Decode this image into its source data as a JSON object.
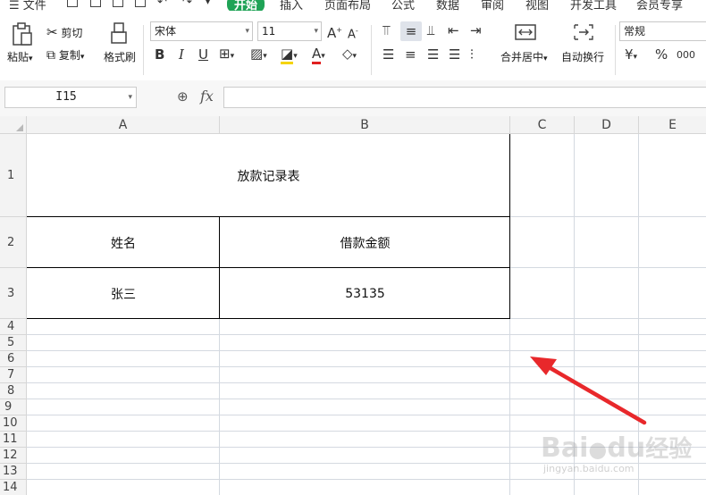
{
  "menubar": {
    "file_label": "文件",
    "tabs": [
      {
        "label": "开始",
        "active": true
      },
      {
        "label": "插入"
      },
      {
        "label": "页面布局"
      },
      {
        "label": "公式"
      },
      {
        "label": "数据"
      },
      {
        "label": "审阅"
      },
      {
        "label": "视图"
      },
      {
        "label": "开发工具"
      },
      {
        "label": "会员专享"
      }
    ]
  },
  "ribbon": {
    "paste_label": "粘贴",
    "cut_label": "剪切",
    "copy_label": "复制",
    "format_painter_label": "格式刷",
    "font_name": "宋体",
    "font_size": "11",
    "merge_center_label": "合并居中",
    "wrap_text_label": "自动换行",
    "number_format": "常规",
    "currency_symbol": "¥",
    "percent_symbol": "%",
    "thousands_symbol": "000",
    "font_color": "#e02020",
    "fill_color": "#f5d400"
  },
  "formula_bar": {
    "cell_ref": "I15",
    "fx_label": "fx",
    "value": ""
  },
  "sheet": {
    "columns": [
      "A",
      "B",
      "C",
      "D",
      "E"
    ],
    "rows": [
      "1",
      "2",
      "3",
      "4",
      "5",
      "6",
      "7",
      "8",
      "9",
      "10",
      "11",
      "12",
      "13",
      "14"
    ],
    "title": "放款记录表",
    "header_name": "姓名",
    "header_amount": "借款金额",
    "row_name": "张三",
    "row_amount": "53135"
  },
  "watermark": {
    "brand": "Bai",
    "brand2": "du",
    "brand_cn": "经验",
    "url": "jingyan.baidu.com"
  },
  "colors": {
    "accent": "#1fa356",
    "annotation_arrow": "#e8282b"
  }
}
